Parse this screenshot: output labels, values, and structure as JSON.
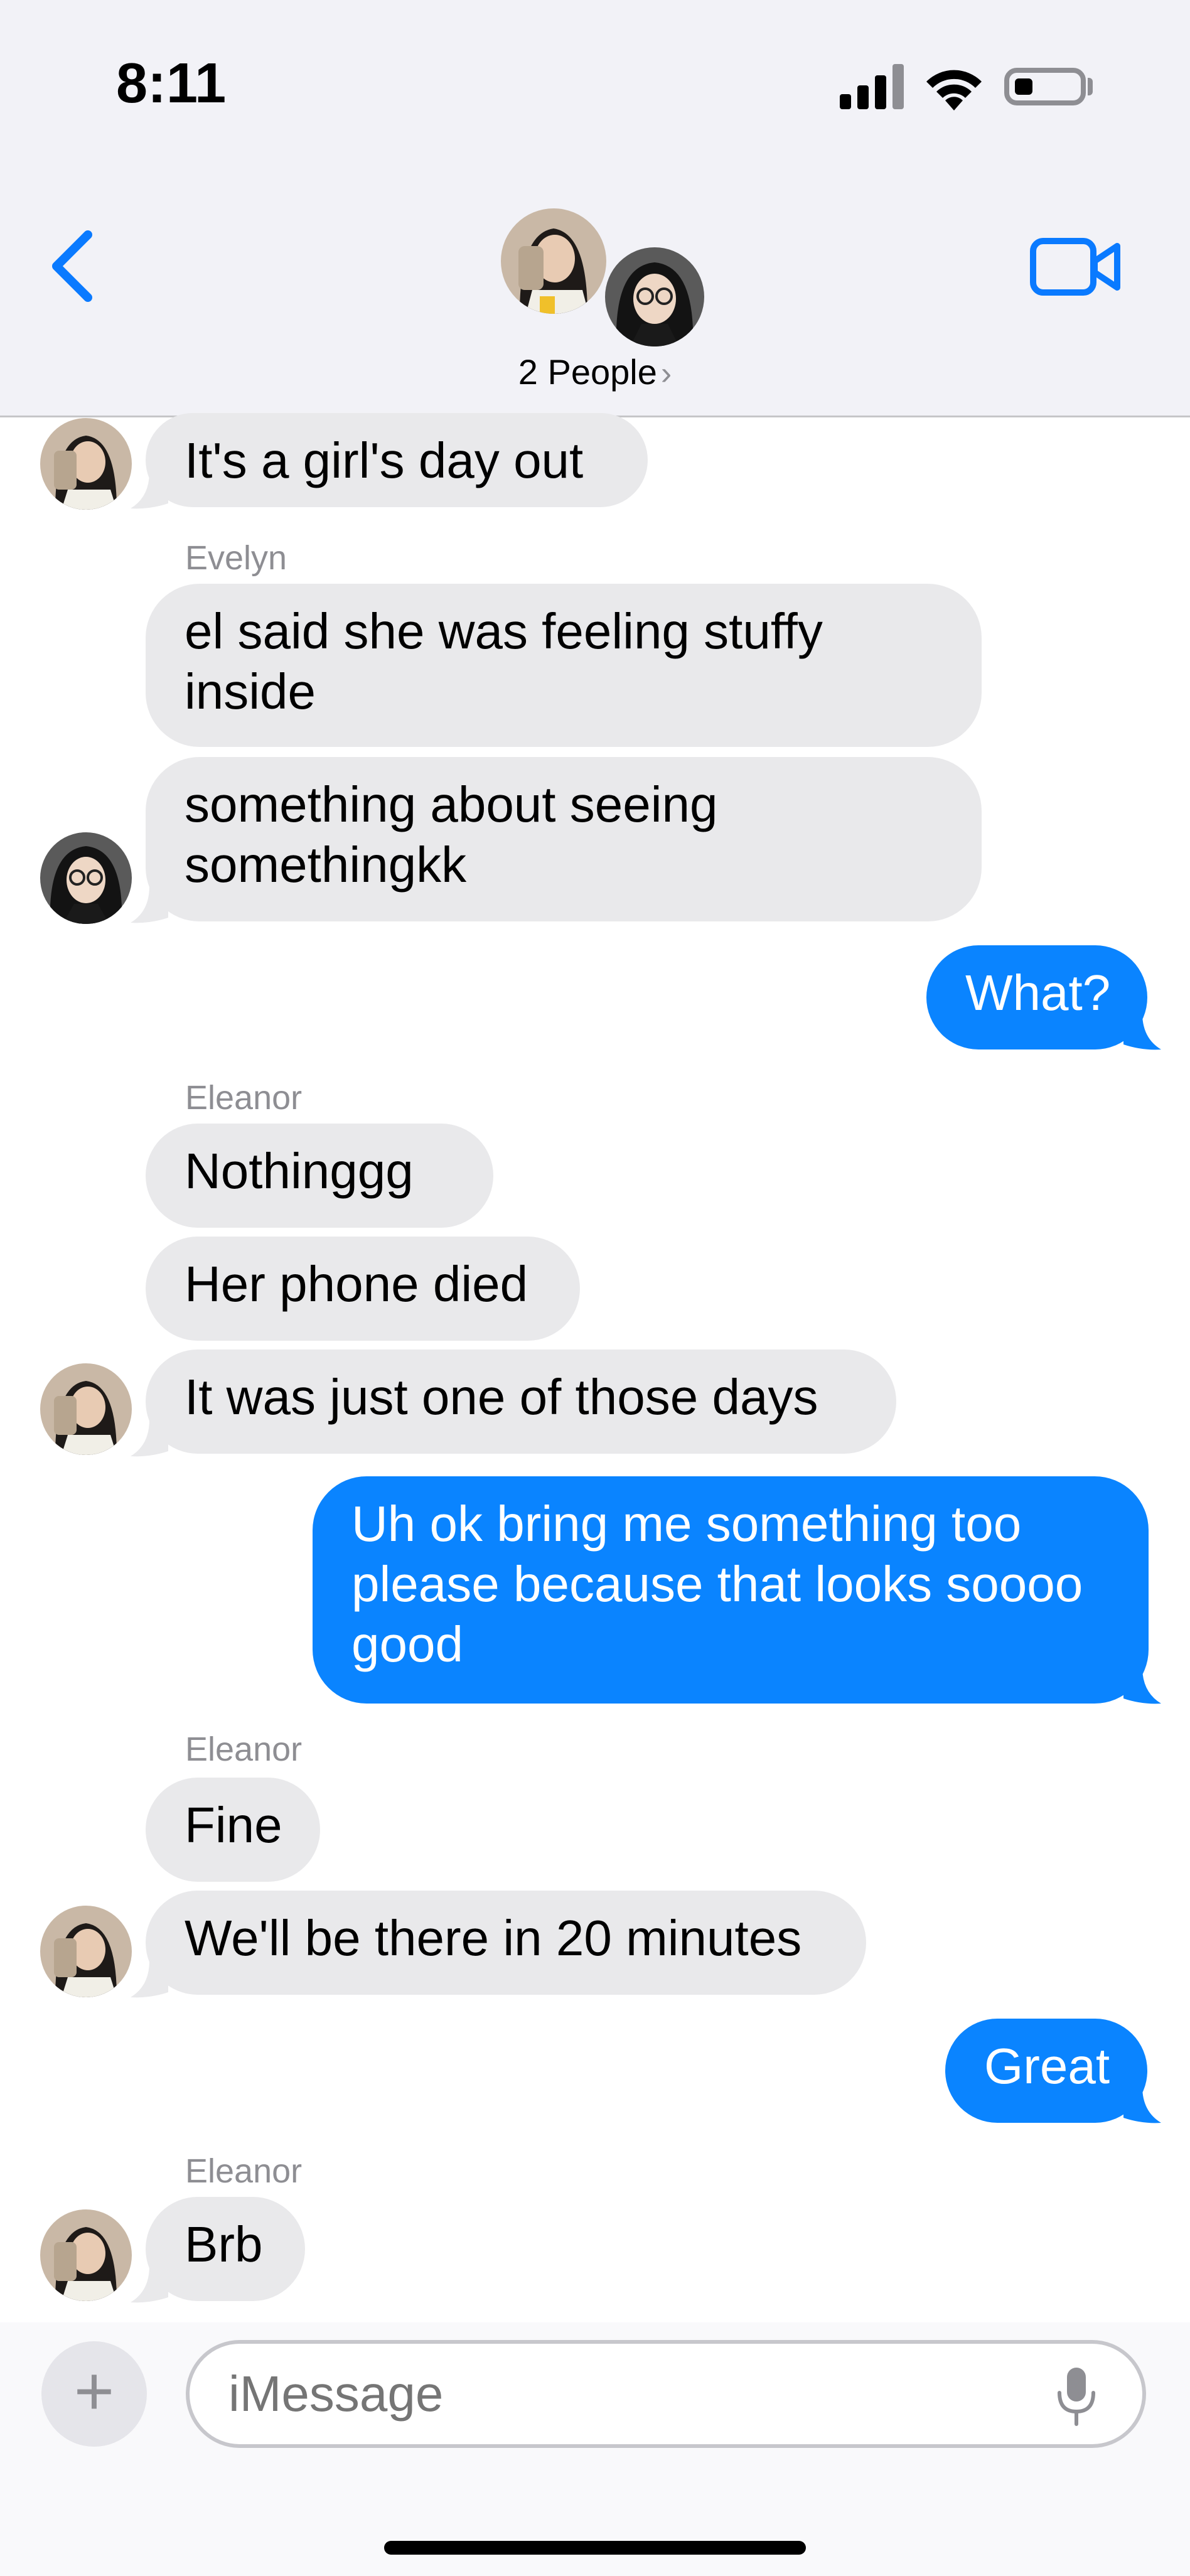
{
  "status_bar": {
    "time": "8:11",
    "signal_icon": "cellular-signal-icon",
    "wifi_icon": "wifi-icon",
    "battery_icon": "battery-low-icon"
  },
  "nav": {
    "back_icon": "chevron-left-icon",
    "video_icon": "video-camera-icon",
    "group_label": "2 People",
    "chevron": "›"
  },
  "thread": {
    "m1": "It's a girl's day out",
    "sender_evelyn": "Evelyn",
    "m2": "el said she was feeling stuffy\ninside",
    "m3": "something about seeing\nsomethingkk",
    "m4": "What?",
    "sender_eleanor_1": "Eleanor",
    "m5": "Nothinggg",
    "m6": "Her phone died",
    "m7": "It was just one of those days",
    "m8": "Uh ok bring me something too\nplease because that looks soooo\ngood",
    "sender_eleanor_2": "Eleanor",
    "m9": "Fine",
    "m10": "We'll be there in 20 minutes",
    "m11": "Great",
    "sender_eleanor_3": "Eleanor",
    "m12": "Brb"
  },
  "input": {
    "plus": "+",
    "placeholder": "iMessage",
    "mic_icon": "microphone-icon"
  },
  "colors": {
    "outgoing": "#0a84ff",
    "incoming": "#e9e9eb",
    "accent": "#0a7aff"
  }
}
